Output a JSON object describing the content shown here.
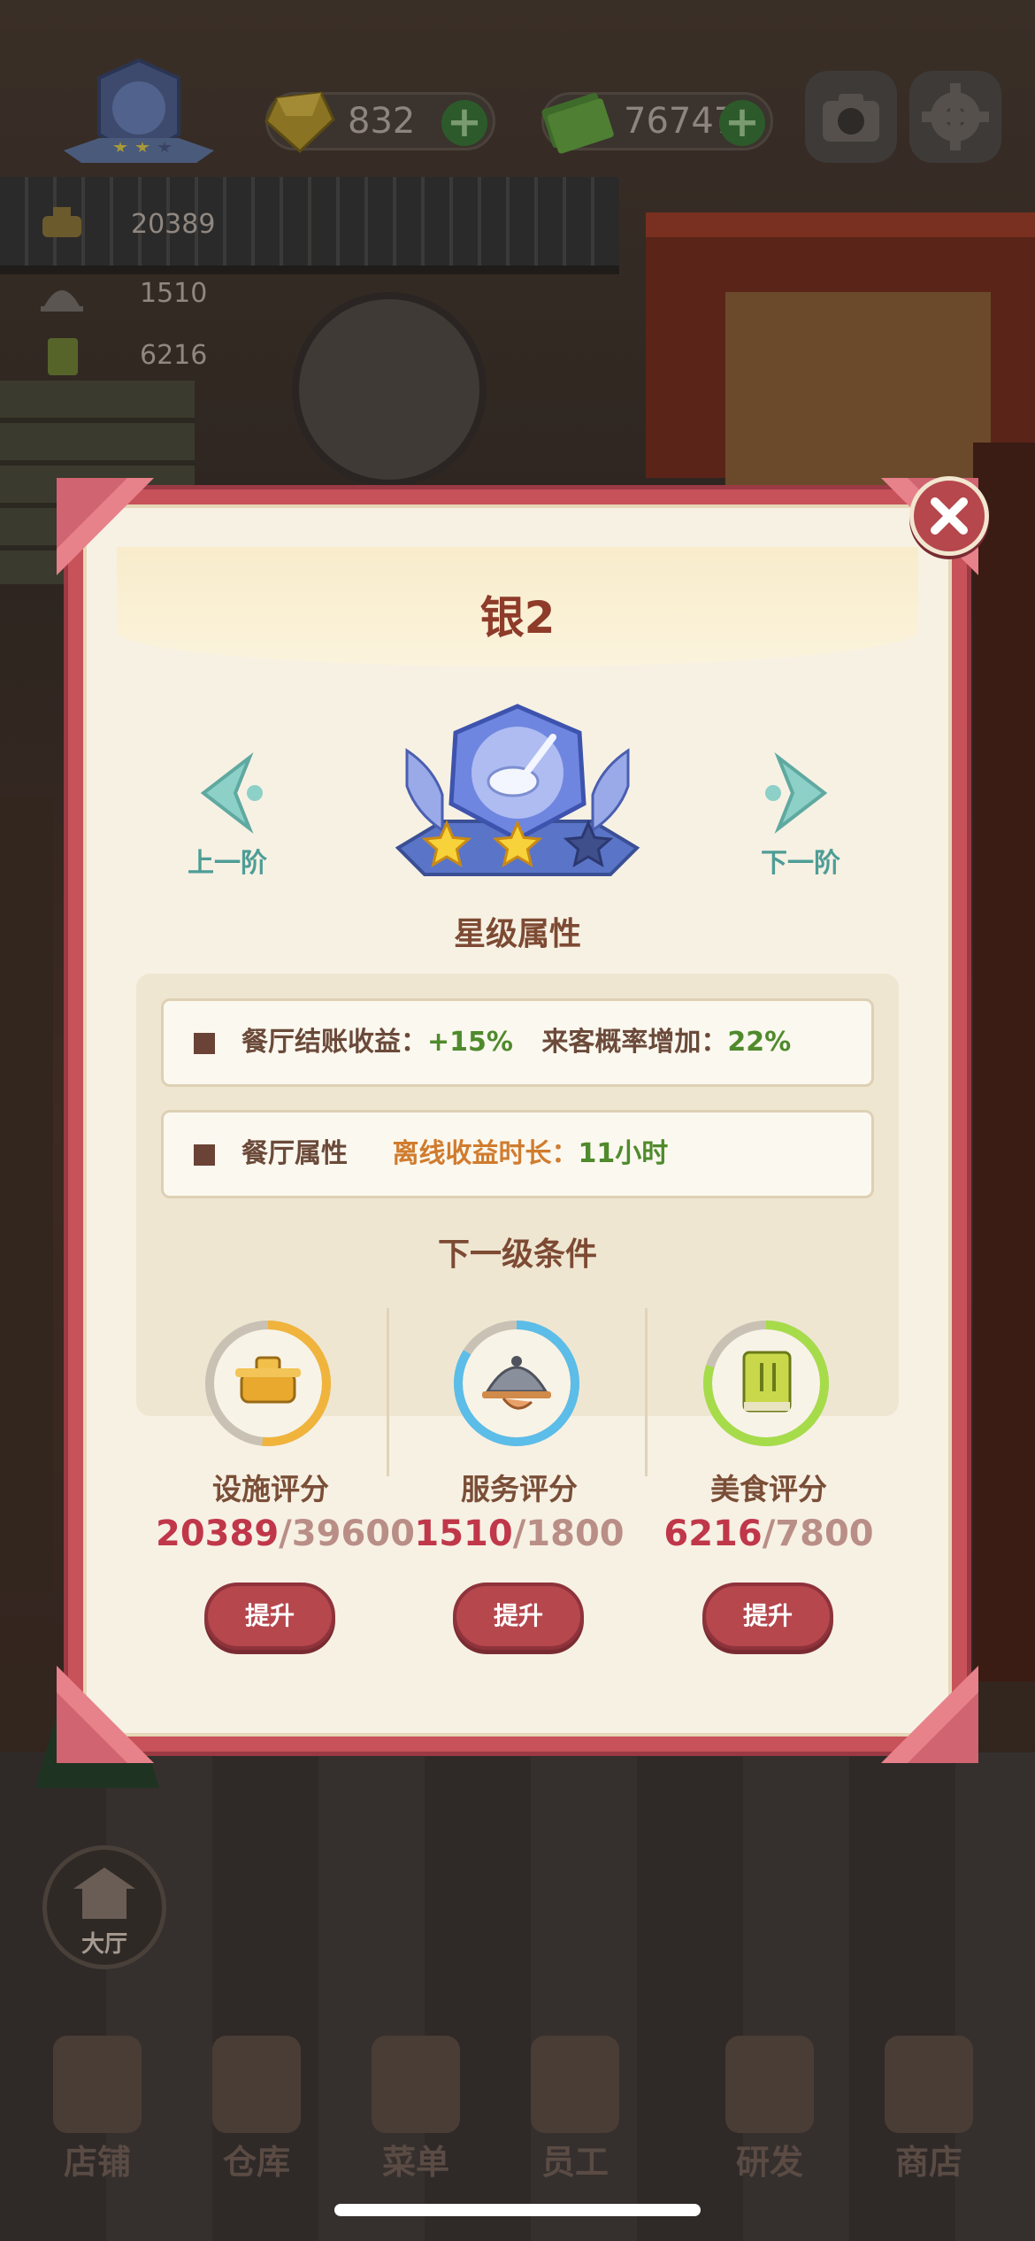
{
  "hud": {
    "gems": "832",
    "cash": "76747",
    "side_stats": [
      "20389",
      "1510",
      "6216"
    ]
  },
  "dialog": {
    "title": "银2",
    "prev_label": "上一阶",
    "next_label": "下一阶",
    "stars_filled": 2,
    "stars_total": 3,
    "star_section_title": "星级属性",
    "attr1_label": "餐厅结账收益：",
    "attr1_value": "+15%",
    "attr1_label2": "来客概率增加：",
    "attr1_value2": "22%",
    "attr2_label": "餐厅属性",
    "attr2_sub_label": "离线收益时长：",
    "attr2_value": "11小时",
    "next_section_title": "下一级条件",
    "requirements": [
      {
        "name": "设施评分",
        "current": "20389",
        "target": "/39600",
        "button": "提升",
        "ring_color": "#f0b43c",
        "progress": 0.515
      },
      {
        "name": "服务评分",
        "current": "1510",
        "target": "/1800",
        "button": "提升",
        "ring_color": "#5bbde8",
        "progress": 0.839
      },
      {
        "name": "美食评分",
        "current": "6216",
        "target": "/7800",
        "button": "提升",
        "ring_color": "#a6dc4a",
        "progress": 0.797
      }
    ]
  },
  "hall_label": "大厅",
  "nav": [
    "店铺",
    "仓库",
    "菜单",
    "员工",
    "研发",
    "商店"
  ]
}
